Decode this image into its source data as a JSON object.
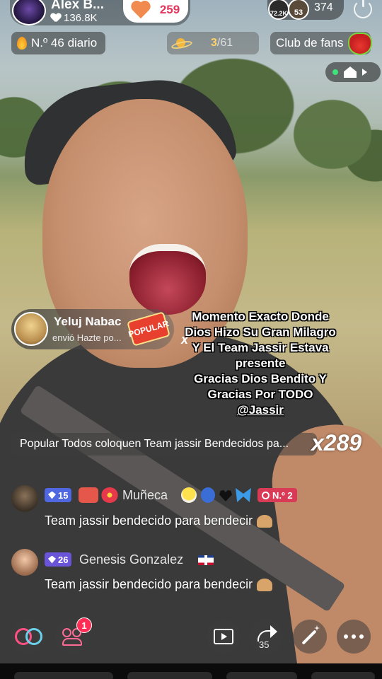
{
  "header": {
    "host_name": "Alex B...",
    "followers": "136.8K",
    "likes": "259",
    "viewer_badge_1": "72.2K",
    "viewer_badge_2": "53",
    "viewer_count": "374"
  },
  "chips": {
    "daily_rank": "N.º 46 diario",
    "planet_current": "3",
    "planet_total": "/61",
    "fan_club": "Club de fans"
  },
  "gift": {
    "user": "Yeluj Nabac",
    "action": "envió Hazte po...",
    "sticker": "POPULAR",
    "x": "x"
  },
  "caption": {
    "lines": [
      "Momento Exacto Donde",
      "Dios Hizo Su Gran Milagro",
      "Y El Team Jassir Estava",
      "presente",
      "Gracias Dios Bendito Y",
      "Gracias Por TODO"
    ],
    "mention": "@Jassir"
  },
  "popular": {
    "text": "Popular Todos coloquen Team jassir Bendecidos pa...",
    "multiplier": "x289"
  },
  "comments": [
    {
      "level": "15",
      "user": "Muñeca",
      "rank": "N.º 2",
      "text": "Team jassir bendecido para bendecir"
    },
    {
      "level": "26",
      "user": "Genesis Gonzalez",
      "text": "Team jassir bendecido para bendecir"
    }
  ],
  "bottom": {
    "guests_badge": "1",
    "share_count": "35"
  },
  "icons": [
    "heart-icon",
    "flame-icon",
    "planet-icon",
    "fan-mascot-icon",
    "live-dot-icon",
    "home-play-icon",
    "play-icon",
    "power-icon",
    "diamond-icon",
    "flower-icon",
    "chick-icon",
    "globe-icon",
    "black-heart-icon",
    "butterfly-icon",
    "clock-icon",
    "dominican-flag-icon",
    "pray-hands-icon",
    "link-icon",
    "guests-icon",
    "film-icon",
    "share-icon",
    "magic-wand-icon",
    "more-dots-icon"
  ]
}
